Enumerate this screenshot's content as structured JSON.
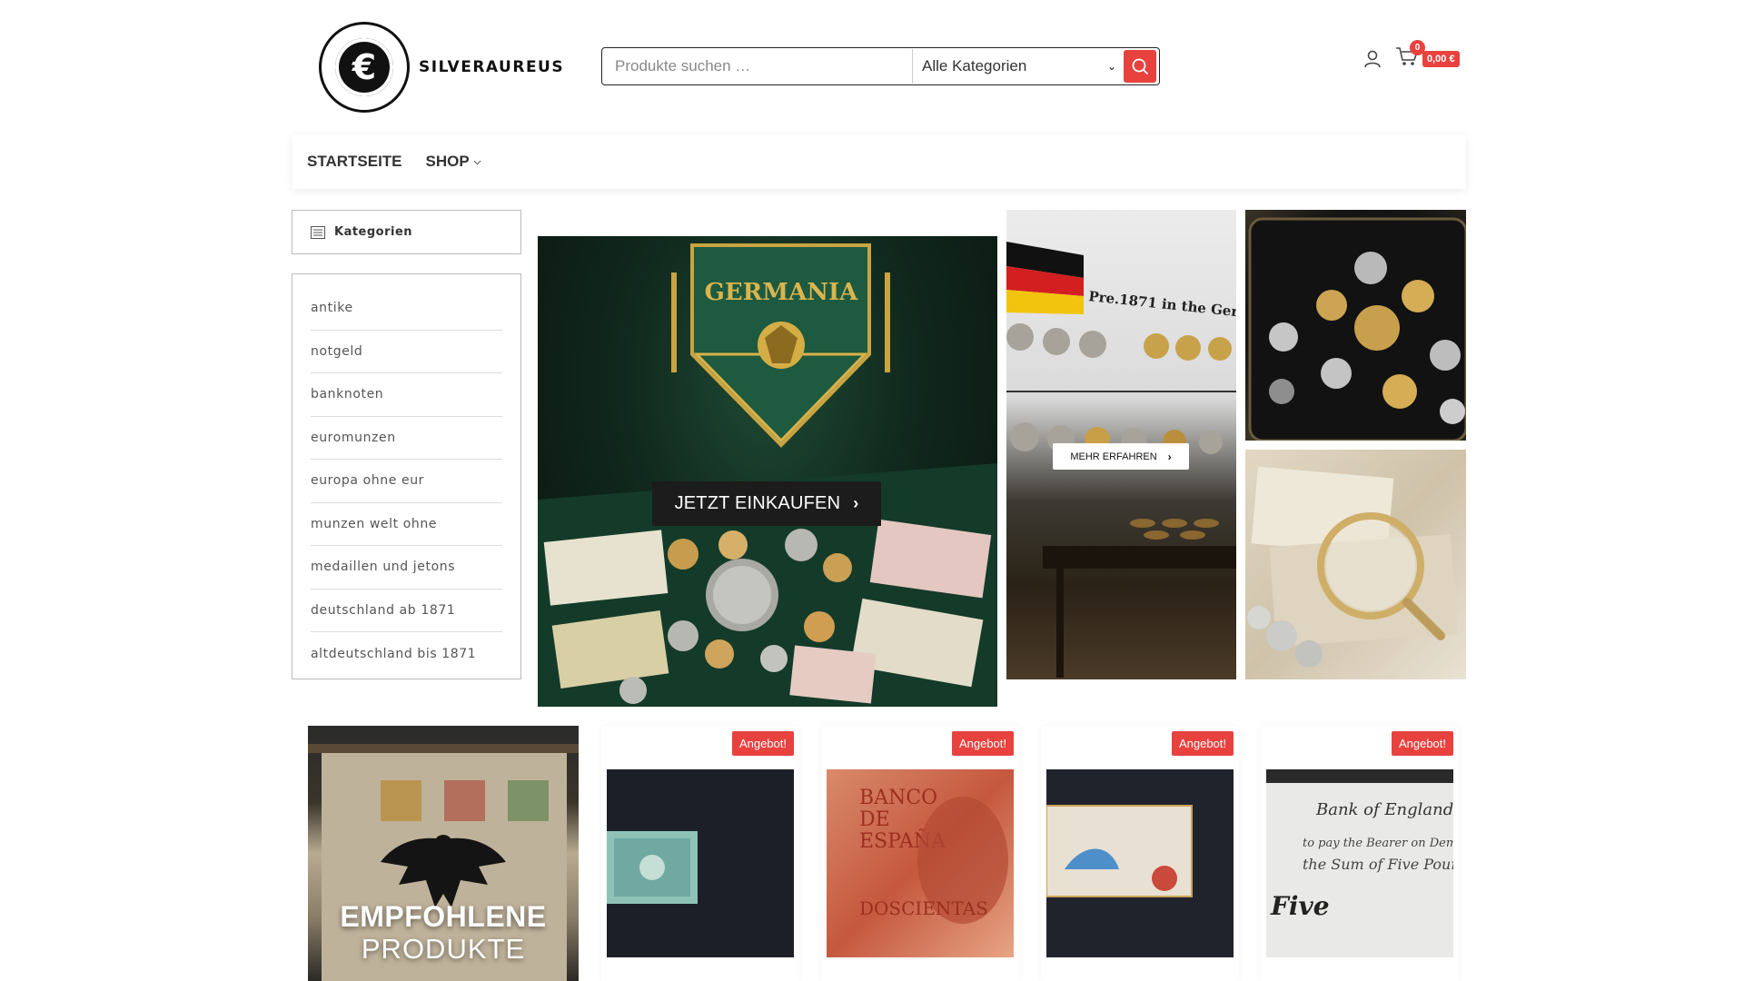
{
  "header": {
    "logo_text": "SILVERAUREUS",
    "search_placeholder": "Produkte suchen …",
    "category_select": "Alle Kategorien",
    "cart_count": "0",
    "cart_total": "0,00 €"
  },
  "nav": {
    "items": [
      {
        "label": "STARTSEITE"
      },
      {
        "label": "SHOP"
      }
    ]
  },
  "sidebar": {
    "heading": "Kategorien",
    "items": [
      {
        "label": "antike"
      },
      {
        "label": "notgeld"
      },
      {
        "label": "banknoten"
      },
      {
        "label": "euromunzen"
      },
      {
        "label": "europa ohne eur"
      },
      {
        "label": "munzen welt ohne"
      },
      {
        "label": "medaillen und jetons"
      },
      {
        "label": "deutschland ab 1871"
      },
      {
        "label": "altdeutschland bis 1871"
      }
    ]
  },
  "banners": {
    "main_button": "JETZT EINKAUFEN",
    "side_button": "MEHR ERFAHREN",
    "pennant_text": "GERMANIA",
    "wall_text": "Pre.1871 in the Germ"
  },
  "featured": {
    "line1": "EMPFOHLENE",
    "line2": "PRODUKTE"
  },
  "products": [
    {
      "badge": "Angebot!"
    },
    {
      "badge": "Angebot!"
    },
    {
      "badge": "Angebot!"
    },
    {
      "badge": "Angebot!"
    }
  ],
  "colors": {
    "accent": "#e8423f",
    "dark": "#1c1c1c"
  }
}
